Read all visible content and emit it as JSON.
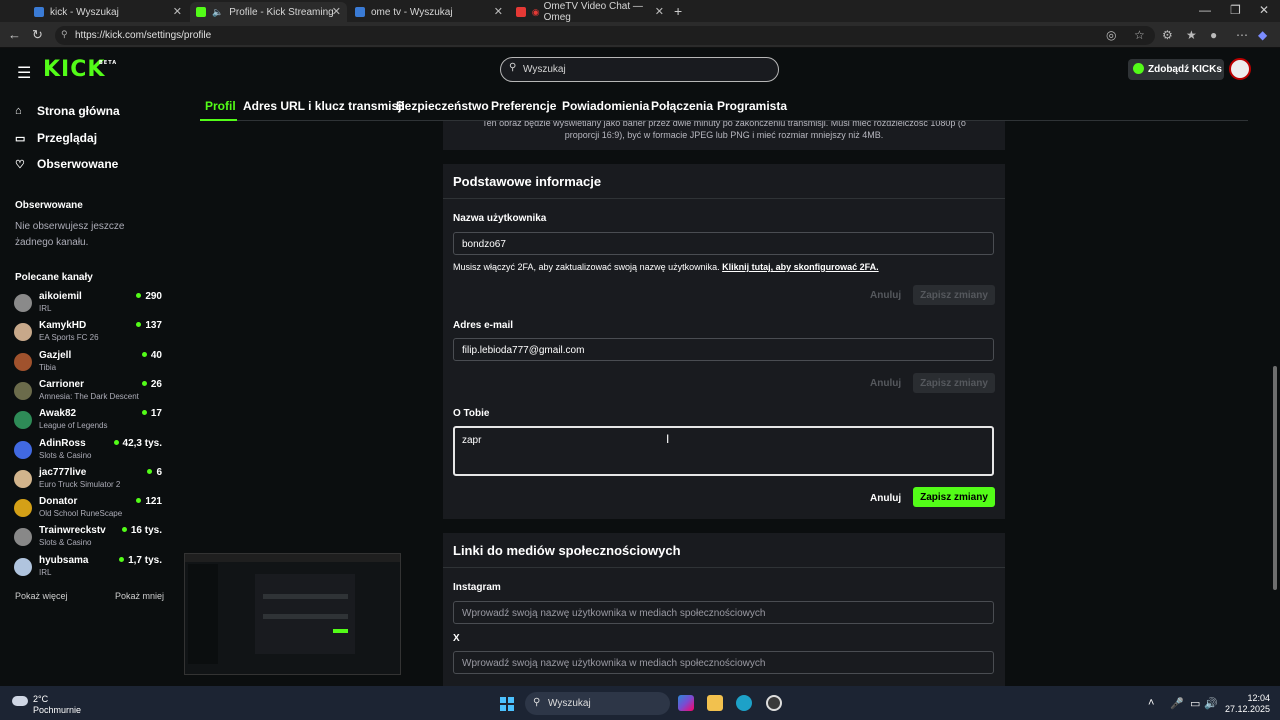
{
  "browser": {
    "tabs": [
      {
        "title": "kick - Wyszukaj"
      },
      {
        "title": "Profile - Kick Streaming"
      },
      {
        "title": "ome tv - Wyszukaj"
      },
      {
        "title": "OmeTV Video Chat — Omeg"
      }
    ],
    "new_tab": "+",
    "url": "https://kick.com/settings/profile"
  },
  "header": {
    "logo": "KICK",
    "logo_badge": "BETA",
    "search_placeholder": "Wyszukaj",
    "get_kicks": "Zdobądź KICKs"
  },
  "sidebar": {
    "nav": [
      {
        "label": "Strona główna",
        "icon": "home-icon"
      },
      {
        "label": "Przeglądaj",
        "icon": "browse-icon"
      },
      {
        "label": "Obserwowane",
        "icon": "heart-icon"
      }
    ],
    "followed_title": "Obserwowane",
    "followed_empty": "Nie obserwujesz jeszcze żadnego kanału.",
    "recommended_title": "Polecane kanały",
    "channels": [
      {
        "name": "aikoiemil",
        "game": "IRL",
        "viewers": "290",
        "color": "#8a8a8a"
      },
      {
        "name": "KamykHD",
        "game": "EA Sports FC 26",
        "viewers": "137",
        "color": "#c7a88a"
      },
      {
        "name": "Gazjell",
        "game": "Tibia",
        "viewers": "40",
        "color": "#a0522d"
      },
      {
        "name": "Carrioner",
        "game": "Amnesia: The Dark Descent",
        "viewers": "26",
        "color": "#6b6b4b"
      },
      {
        "name": "Awak82",
        "game": "League of Legends",
        "viewers": "17",
        "color": "#2e8b57"
      },
      {
        "name": "AdinRoss",
        "game": "Slots & Casino",
        "viewers": "42,3 tys.",
        "color": "#4169e1"
      },
      {
        "name": "jac777live",
        "game": "Euro Truck Simulator 2",
        "viewers": "6",
        "color": "#d2b48c"
      },
      {
        "name": "Donator",
        "game": "Old School RuneScape",
        "viewers": "121",
        "color": "#d4a017"
      },
      {
        "name": "Trainwreckstv",
        "game": "Slots & Casino",
        "viewers": "16 tys.",
        "color": "#888888"
      },
      {
        "name": "hyubsama",
        "game": "IRL",
        "viewers": "1,7 tys.",
        "color": "#b0c4de"
      }
    ],
    "show_more": "Pokaż więcej",
    "show_less": "Pokaż mniej"
  },
  "settings_tabs": [
    "Profil",
    "Adres URL i klucz transmisji",
    "Bezpieczeństwo",
    "Preferencje",
    "Powiadomienia",
    "Połączenia",
    "Programista"
  ],
  "banner_card": {
    "text_line1": "Ten obraz będzie wyświetlany jako baner przez dwie minuty po zakończeniu transmisji. Musi mieć rozdzielczość 1080p (o",
    "text_line2": "proporcji 16:9), być w formacie JPEG lub PNG i mieć rozmiar mniejszy niż 4MB."
  },
  "basic_info": {
    "title": "Podstawowe informacje",
    "username_label": "Nazwa użytkownika",
    "username_value": "bondzo67",
    "note_text": "Musisz włączyć 2FA, aby zaktualizować swoją nazwę użytkownika. ",
    "note_link": "Kliknij tutaj, aby skonfigurować 2FA.",
    "email_label": "Adres e-mail",
    "email_value": "filip.lebioda777@gmail.com",
    "bio_label": "O Tobie",
    "bio_value": "zapr",
    "cancel": "Anuluj",
    "save": "Zapisz zmiany"
  },
  "social": {
    "title": "Linki do mediów społecznościowych",
    "instagram_label": "Instagram",
    "x_label": "X",
    "placeholder": "Wprowadź swoją nazwę użytkownika w mediach społecznościowych"
  },
  "taskbar": {
    "temp": "2°C",
    "weather": "Pochmurnie",
    "search": "Wyszukaj",
    "time": "12:04",
    "date": "27.12.2025"
  }
}
